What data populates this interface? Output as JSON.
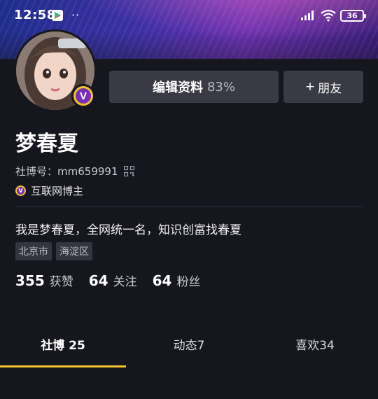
{
  "status_bar": {
    "time": "12:58",
    "dots": "··",
    "battery": "36"
  },
  "header": {
    "edit_label": "编辑资料",
    "edit_percent": "83%",
    "add_friend_label": "朋友",
    "add_friend_plus": "+"
  },
  "profile": {
    "nickname": "梦春夏",
    "uid_label": "社博号：",
    "uid_value": "mm659991",
    "certification": "互联网博主",
    "badge_letter": "V",
    "bio": "我是梦春夏，全网统一名，知识创富找春夏",
    "tags": [
      "北京市",
      "海淀区"
    ]
  },
  "stats": [
    {
      "num": "355",
      "label": "获赞"
    },
    {
      "num": "64",
      "label": "关注"
    },
    {
      "num": "64",
      "label": "粉丝"
    }
  ],
  "tabs": [
    {
      "label": "社博 25",
      "active": true
    },
    {
      "label": "动态7",
      "active": false
    },
    {
      "label": "喜欢34",
      "active": false
    }
  ],
  "colors": {
    "accent": "#f2c230",
    "badge_purple": "#7a2fb8",
    "background": "#15161e",
    "button_bg": "#393a44"
  },
  "icons": [
    "play-store-icon",
    "more-dots-icon",
    "signal-icon",
    "wifi-icon",
    "battery-icon",
    "vip-badge-icon",
    "qr-code-icon",
    "certification-icon"
  ]
}
